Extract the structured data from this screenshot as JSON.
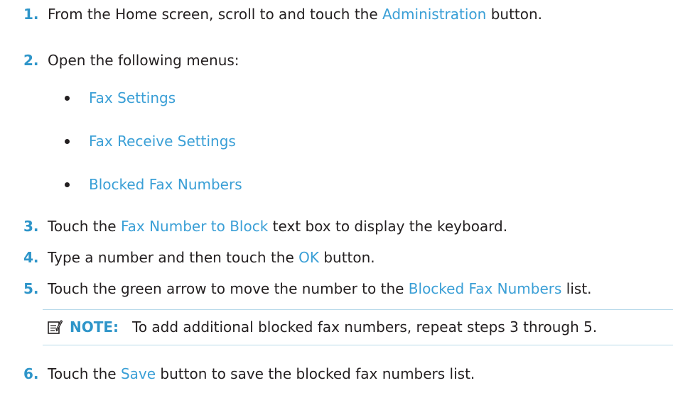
{
  "steps": [
    {
      "num": "1.",
      "parts": [
        {
          "text": "From the Home screen, scroll to and touch the ",
          "link": false
        },
        {
          "text": "Administration",
          "link": true
        },
        {
          "text": " button.",
          "link": false
        }
      ]
    },
    {
      "num": "2.",
      "parts": [
        {
          "text": "Open the following menus:",
          "link": false
        }
      ]
    },
    {
      "num": "3.",
      "parts": [
        {
          "text": "Touch the ",
          "link": false
        },
        {
          "text": "Fax Number to Block",
          "link": true
        },
        {
          "text": " text box to display the keyboard.",
          "link": false
        }
      ]
    },
    {
      "num": "4.",
      "parts": [
        {
          "text": "Type a number and then touch the ",
          "link": false
        },
        {
          "text": "OK",
          "link": true
        },
        {
          "text": " button.",
          "link": false
        }
      ]
    },
    {
      "num": "5.",
      "parts": [
        {
          "text": "Touch the green arrow to move the number to the ",
          "link": false
        },
        {
          "text": "Blocked Fax Numbers",
          "link": true
        },
        {
          "text": " list.",
          "link": false
        }
      ]
    },
    {
      "num": "6.",
      "parts": [
        {
          "text": "Touch the ",
          "link": false
        },
        {
          "text": "Save",
          "link": true
        },
        {
          "text": " button to save the blocked fax numbers list.",
          "link": false
        }
      ]
    }
  ],
  "menus": [
    "Fax Settings",
    "Fax Receive Settings",
    "Blocked Fax Numbers"
  ],
  "note": {
    "label": "NOTE:",
    "text": "To add additional blocked fax numbers, repeat steps 3 through 5.",
    "icon": "note-icon"
  },
  "colors": {
    "accent": "#2e95c9",
    "link": "#3a9fd6",
    "text": "#231f20"
  }
}
